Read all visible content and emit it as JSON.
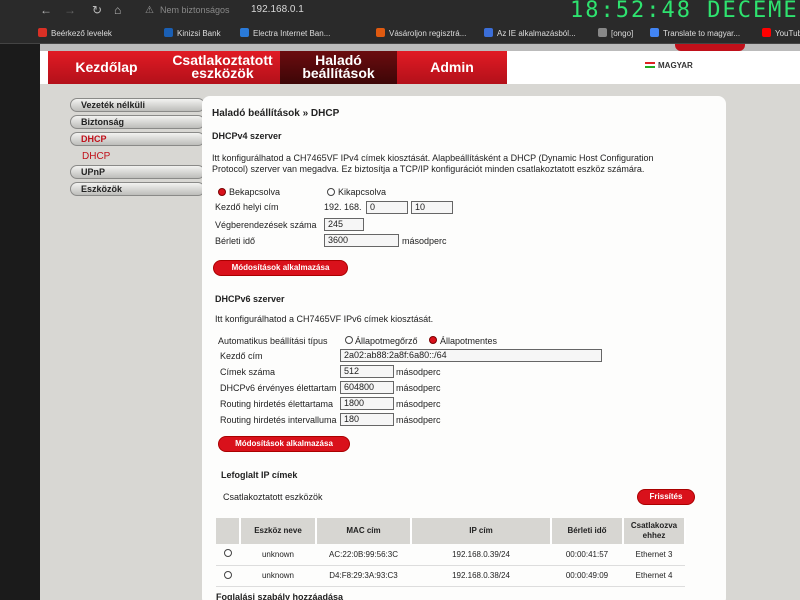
{
  "browser": {
    "back_icon": "←",
    "forward_icon": "→",
    "reload_icon": "↻",
    "home_icon": "⌂",
    "warning_icon": "⚠",
    "not_secure": "Nem biztonságos",
    "url": "192.168.0.1",
    "clock": "18:52:48  DECEME"
  },
  "bookmarks": [
    {
      "label": "Beérkező levelek",
      "color": "#d93025"
    },
    {
      "label": "Kinizsi Bank",
      "color": "#1a5fb4"
    },
    {
      "label": "Electra Internet Ban...",
      "color": "#2a7ad9"
    },
    {
      "label": "Vásároljon regisztrá...",
      "color": "#e05a10"
    },
    {
      "label": "Az IE alkalmazásból...",
      "color": "#3b6ed8"
    },
    {
      "label": "[ongo]",
      "color": "#888888"
    },
    {
      "label": "Translate to magyar...",
      "color": "#4285f4"
    },
    {
      "label": "YouTub",
      "color": "#ff0000"
    }
  ],
  "nav": {
    "home": "Kezdőlap",
    "devices_1": "Csatlakoztatott",
    "devices_2": "eszközök",
    "advanced_1": "Haladó",
    "advanced_2": "beállítások",
    "admin": "Admin",
    "language": "MAGYAR"
  },
  "sidebar": {
    "items": [
      "Vezeték nélküli",
      "Biztonság",
      "DHCP",
      "UPnP",
      "Eszközök"
    ],
    "sub_item": "DHCP"
  },
  "page": {
    "breadcrumb": "Haladó beállítások » DHCP"
  },
  "dhcpv4": {
    "title": "DHCPv4 szerver",
    "desc_1": "Itt konfigurálhatod a CH7465VF IPv4 címek kiosztását. Alapbeállításként a DHCP (Dynamic Host Configuration",
    "desc_2": "Protocol) szerver van megadva. Ez biztosítja a TCP/IP konfigurációt minden csatlakoztatott eszköz számára.",
    "on_label": "Bekapcsolva",
    "off_label": "Kikapcsolva",
    "start_label": "Kezdő helyi cím",
    "start_prefix": "192. 168.",
    "start_octet3": "0",
    "start_octet4": "10",
    "count_label": "Végberendezések száma",
    "count_value": "245",
    "lease_label": "Bérleti idő",
    "lease_value": "3600",
    "lease_unit": "másodperc",
    "apply": "Módosítások alkalmazása"
  },
  "dhcpv6": {
    "title": "DHCPv6 szerver",
    "desc": "Itt konfigurálhatod a CH7465VF IPv6 címek kiosztását.",
    "mode_label": "Automatikus beállítási típus",
    "stateful_label": "Állapotmegőrző",
    "stateless_label": "Állapotmentes",
    "start_label": "Kezdő cím",
    "start_value": "2a02:ab88:2a8f:6a80::/64",
    "count_label": "Címek száma",
    "count_value": "512",
    "valid_label": "DHCPv6 érvényes élettartam",
    "valid_value": "604800",
    "ra_life_label": "Routing hirdetés élettartama",
    "ra_life_value": "1800",
    "ra_int_label": "Routing hirdetés intervalluma",
    "ra_int_value": "180",
    "unit": "másodperc",
    "apply": "Módosítások alkalmazása"
  },
  "leases": {
    "title": "Lefoglalt IP címek",
    "subtitle": "Csatlakoztatott eszközök",
    "refresh": "Frissítés",
    "headers": [
      "",
      "Eszköz neve",
      "MAC cím",
      "IP cím",
      "Bérleti idő",
      "Csatlakozva ehhez"
    ],
    "rows": [
      [
        "unknown",
        "AC:22:0B:99:56:3C",
        "192.168.0.39/24",
        "00:00:41:57",
        "Ethernet 3"
      ],
      [
        "unknown",
        "D4:F8:29:3A:93:C3",
        "192.168.0.38/24",
        "00:00:49:09",
        "Ethernet 4"
      ]
    ],
    "footer": "Foglalási szabály hozzáadása"
  }
}
